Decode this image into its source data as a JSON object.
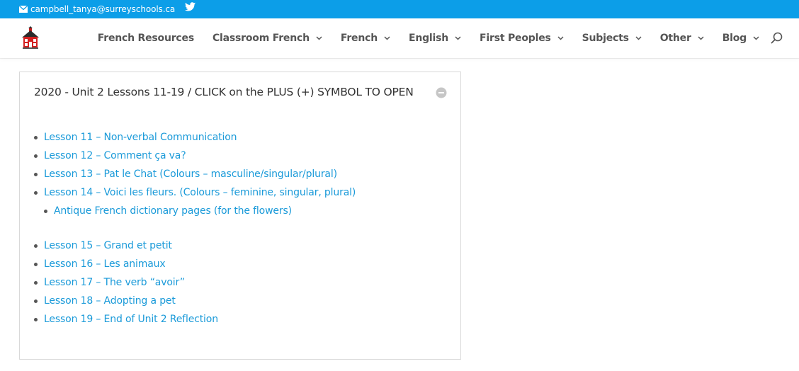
{
  "topbar": {
    "email": "campbell_tanya@surreyschools.ca",
    "mail_icon": "envelope-icon",
    "twitter_icon": "twitter-icon",
    "background": "#0c9ee8"
  },
  "header": {
    "logo_icon": "red-schoolhouse-icon",
    "nav": [
      {
        "label": "French Resources",
        "dropdown": false
      },
      {
        "label": "Classroom French",
        "dropdown": true
      },
      {
        "label": "French",
        "dropdown": true
      },
      {
        "label": "English",
        "dropdown": true
      },
      {
        "label": "First Peoples",
        "dropdown": true
      },
      {
        "label": "Subjects",
        "dropdown": true
      },
      {
        "label": "Other",
        "dropdown": true
      },
      {
        "label": "Blog",
        "dropdown": true
      }
    ],
    "search_icon": "search-icon"
  },
  "accordion": {
    "title": "2020 - Unit 2 Lessons 11-19 / CLICK on the PLUS (+) SYMBOL TO OPEN",
    "toggle_icon": "minus-circle-icon",
    "lessons_a": [
      "Lesson 11 – Non-verbal Communication",
      "Lesson 12 – Comment ça va?",
      "Lesson 13 – Pat le Chat (Colours – masculine/singular/plural)",
      "Lesson 14 – Voici les fleurs. (Colours – feminine, singular, plural)"
    ],
    "sub_lessons": [
      "Antique French dictionary pages (for the flowers)"
    ],
    "lessons_b": [
      "Lesson 15 – Grand et petit",
      "Lesson 16 – Les animaux",
      "Lesson 17 – The verb “avoir”",
      "Lesson 18 – Adopting a pet",
      "Lesson 19 – End of Unit 2 Reflection"
    ],
    "link_color": "#1a9ad9"
  }
}
